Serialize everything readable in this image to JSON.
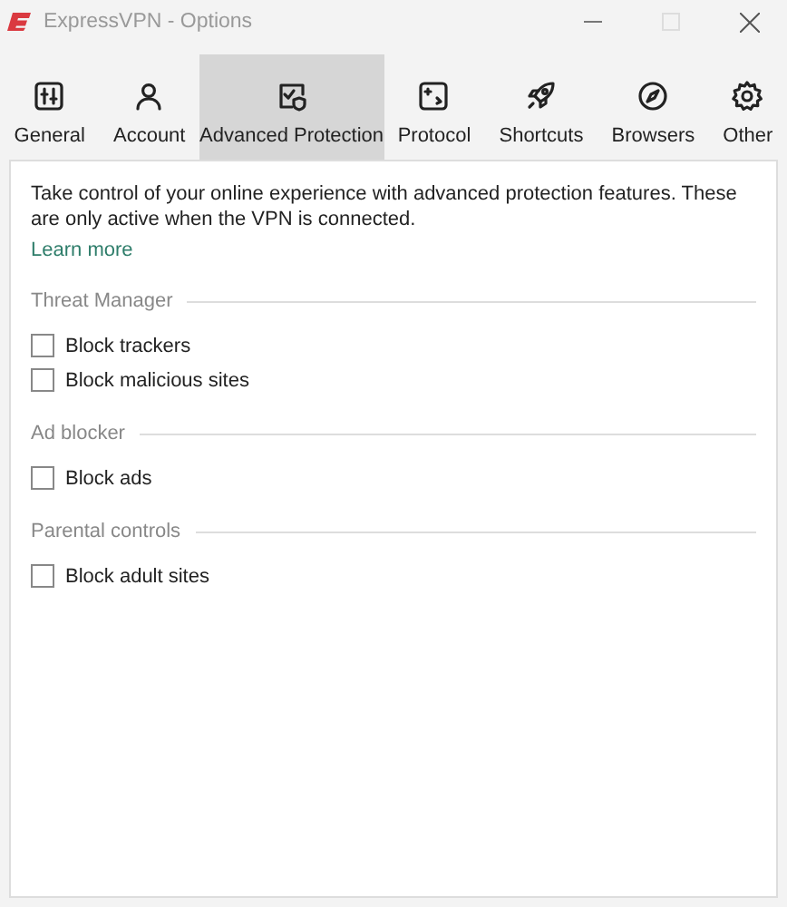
{
  "window": {
    "title": "ExpressVPN - Options"
  },
  "tabs": [
    {
      "label": "General",
      "selected": false
    },
    {
      "label": "Account",
      "selected": false
    },
    {
      "label": "Advanced Protection",
      "selected": true
    },
    {
      "label": "Protocol",
      "selected": false
    },
    {
      "label": "Shortcuts",
      "selected": false
    },
    {
      "label": "Browsers",
      "selected": false
    },
    {
      "label": "Other",
      "selected": false
    }
  ],
  "description": "Take control of your online experience with advanced protection features. These are only active when the VPN is connected.",
  "learn_more": "Learn more",
  "sections": [
    {
      "title": "Threat Manager",
      "options": [
        {
          "label": "Block trackers",
          "checked": false
        },
        {
          "label": "Block malicious sites",
          "checked": false
        }
      ]
    },
    {
      "title": "Ad blocker",
      "options": [
        {
          "label": "Block ads",
          "checked": false
        }
      ]
    },
    {
      "title": "Parental controls",
      "options": [
        {
          "label": "Block adult sites",
          "checked": false
        }
      ]
    }
  ]
}
